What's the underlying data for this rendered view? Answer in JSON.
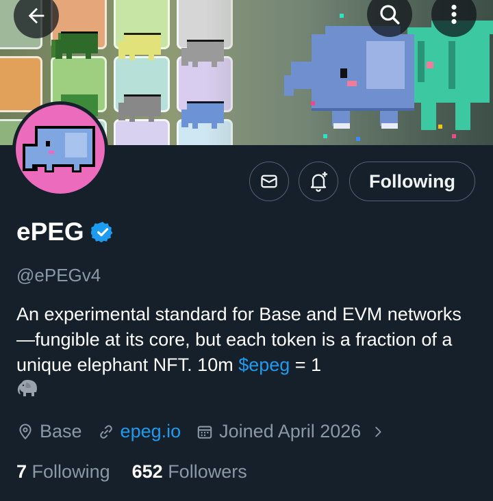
{
  "header": {
    "back_icon": "arrow-left-icon",
    "search_icon": "search-icon",
    "more_icon": "more-vertical-icon"
  },
  "profile": {
    "display_name": "ePEG",
    "verified": true,
    "handle": "@ePEGv4",
    "bio_text": "An experimental standard for Base and EVM networks—fungible at its core, but each token is a fraction of a unique elephant NFT. 10m ",
    "bio_cashtag": "$epeg",
    "bio_suffix": " = 1",
    "bio_emoji": "elephant-emoji",
    "location": "Base",
    "website": "epeg.io",
    "joined": "Joined April 2026",
    "following_count": "7",
    "following_label": "Following",
    "followers_count": "652",
    "followers_label": "Followers"
  },
  "actions": {
    "message_icon": "mail-icon",
    "notify_icon": "bell-plus-icon",
    "follow_label": "Following"
  },
  "colors": {
    "background": "#15202b",
    "accent": "#1d9bf0",
    "muted": "#8b98a5",
    "avatar_bg": "#ec6bbd"
  }
}
